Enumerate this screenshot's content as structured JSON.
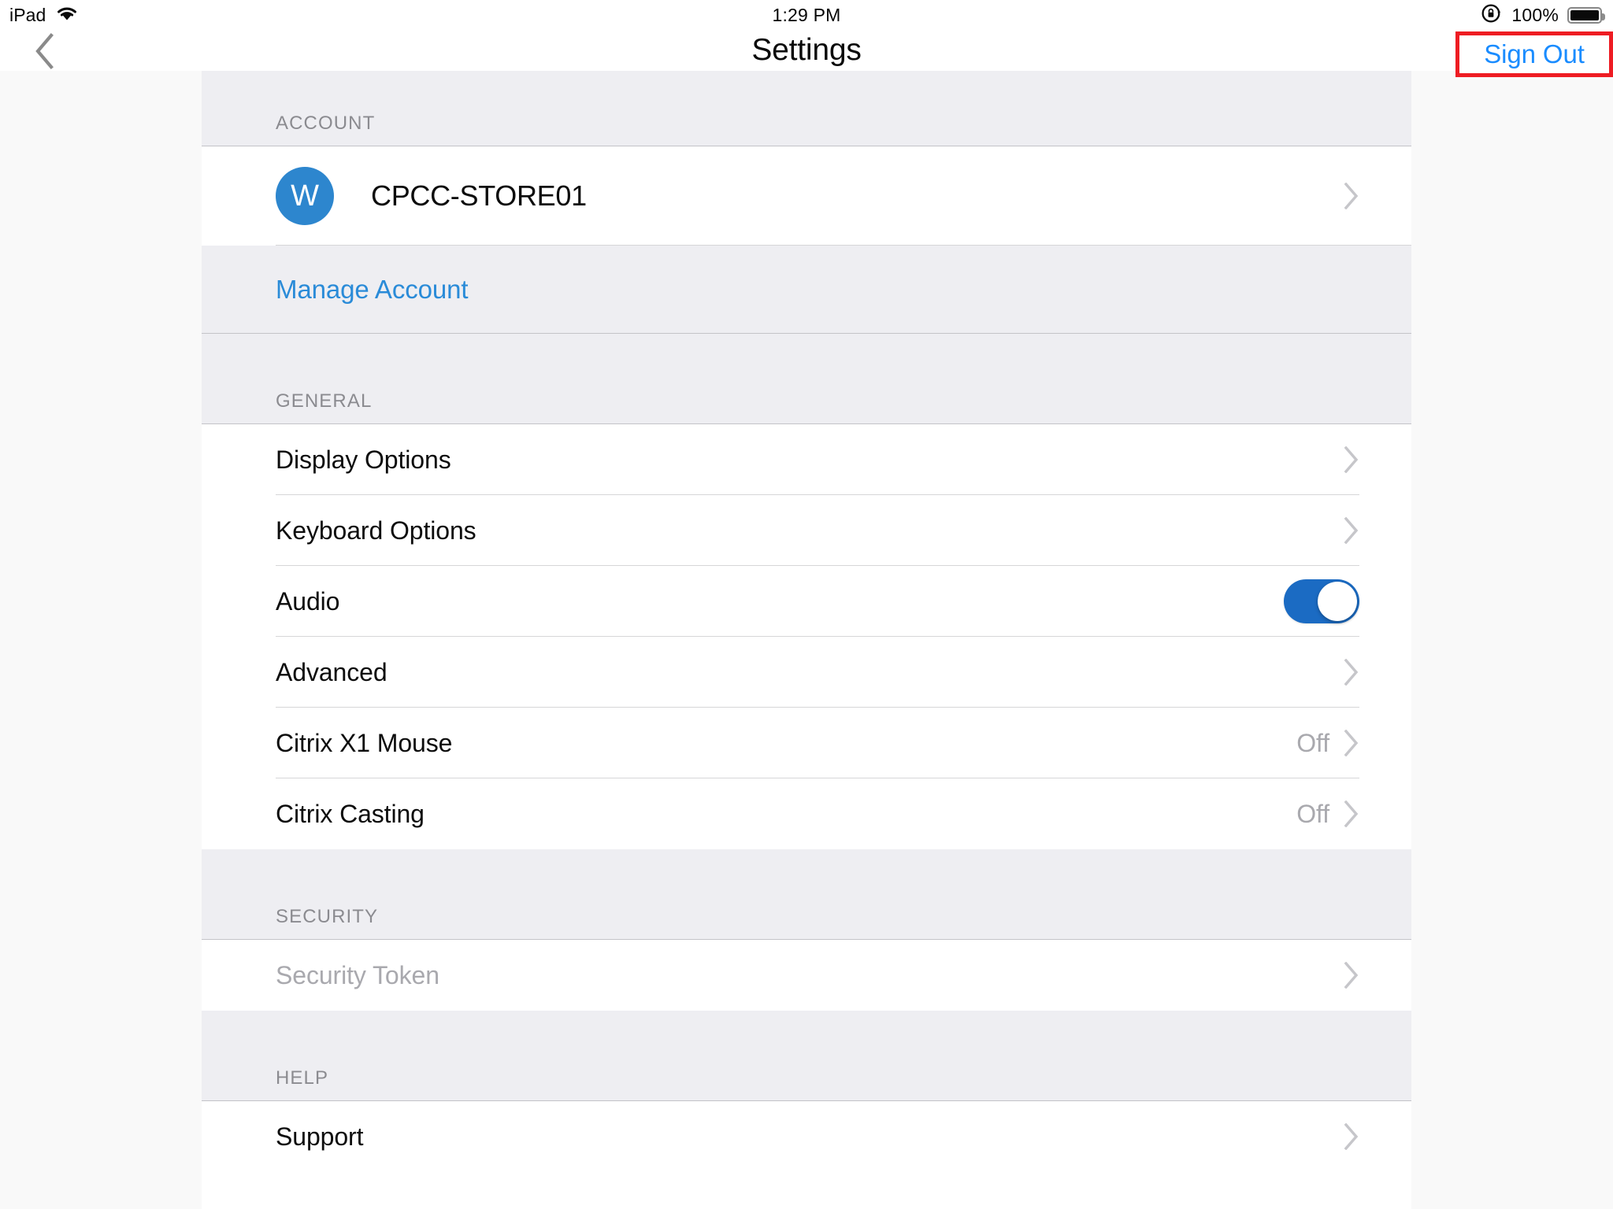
{
  "status_bar": {
    "device_label": "iPad",
    "wifi_icon": "wifi-icon",
    "time": "1:29 PM",
    "rotation_lock_icon": "rotation-lock-icon",
    "battery_percent": "100%",
    "battery_icon": "battery-full-icon"
  },
  "nav_bar": {
    "back_icon": "chevron-left-icon",
    "title": "Settings",
    "sign_out_label": "Sign Out",
    "sign_out_highlight_color": "#ee1c23",
    "sign_out_text_color": "#1a8cff"
  },
  "colors": {
    "accent_blue": "#2a8bd8",
    "avatar_blue": "#2d86ce",
    "toggle_on_blue": "#1b6bc3",
    "section_header_bg": "#eeeef2",
    "page_bg": "#f9f9f9",
    "panel_bg": "#ffffff",
    "muted_text": "#a9a9ae",
    "separator": "#d6d6d8"
  },
  "sections": [
    {
      "header": "ACCOUNT",
      "account": {
        "avatar_initial": "W",
        "name": "CPCC-STORE01",
        "chevron_icon": "chevron-right-icon"
      },
      "manage_account_label": "Manage Account"
    },
    {
      "header": "GENERAL",
      "rows": [
        {
          "label": "Display Options",
          "value": "",
          "control": "chevron",
          "icon": "chevron-right-icon",
          "disabled": false
        },
        {
          "label": "Keyboard Options",
          "value": "",
          "control": "chevron",
          "icon": "chevron-right-icon",
          "disabled": false
        },
        {
          "label": "Audio",
          "value": "",
          "control": "toggle",
          "toggle_on": true,
          "disabled": false
        },
        {
          "label": "Advanced",
          "value": "",
          "control": "chevron",
          "icon": "chevron-right-icon",
          "disabled": false
        },
        {
          "label": "Citrix X1 Mouse",
          "value": "Off",
          "control": "chevron",
          "icon": "chevron-right-icon",
          "disabled": false
        },
        {
          "label": "Citrix Casting",
          "value": "Off",
          "control": "chevron",
          "icon": "chevron-right-icon",
          "disabled": false
        }
      ]
    },
    {
      "header": "SECURITY",
      "rows": [
        {
          "label": "Security Token",
          "value": "",
          "control": "chevron",
          "icon": "chevron-right-icon",
          "disabled": true
        }
      ]
    },
    {
      "header": "HELP",
      "rows": [
        {
          "label": "Support",
          "value": "",
          "control": "chevron",
          "icon": "chevron-right-icon",
          "disabled": false
        }
      ]
    }
  ]
}
